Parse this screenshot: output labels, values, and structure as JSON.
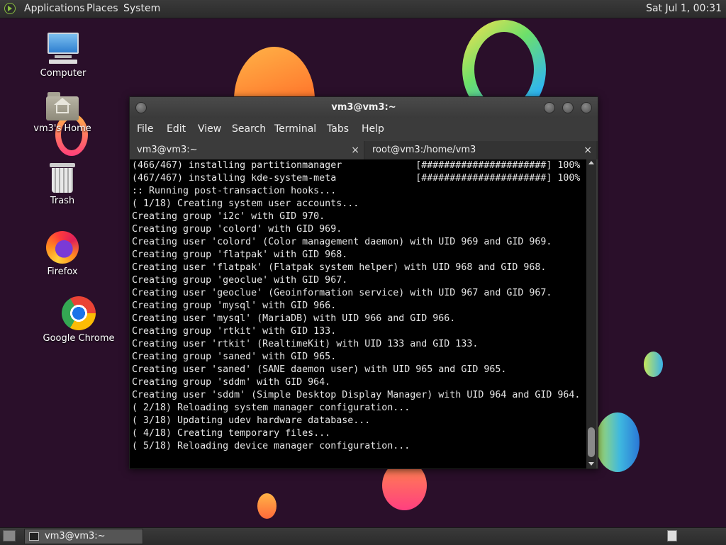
{
  "top_panel": {
    "menus": [
      "Applications",
      "Places",
      "System"
    ],
    "clock": "Sat Jul  1, 00:31",
    "distro_icon": "distro-logo-icon"
  },
  "desktop_icons": [
    {
      "label": "Computer",
      "icon": "computer-icon"
    },
    {
      "label": "vm3's Home",
      "icon": "home-folder-icon"
    },
    {
      "label": "Trash",
      "icon": "trash-icon"
    },
    {
      "label": "Firefox",
      "icon": "firefox-icon"
    },
    {
      "label": "Google Chrome",
      "icon": "chrome-icon"
    }
  ],
  "terminal": {
    "title": "vm3@vm3:~",
    "menu": [
      "File",
      "Edit",
      "View",
      "Search",
      "Terminal",
      "Tabs",
      "Help"
    ],
    "tabs": [
      {
        "label": "vm3@vm3:~",
        "active": true
      },
      {
        "label": "root@vm3:/home/vm3",
        "active": false
      }
    ],
    "tab_close_glyph": "×",
    "lines": [
      "(466/467) installing partitionmanager             [######################] 100%",
      "(467/467) installing kde-system-meta              [######################] 100%",
      ":: Running post-transaction hooks...",
      "( 1/18) Creating system user accounts...",
      "Creating group 'i2c' with GID 970.",
      "Creating group 'colord' with GID 969.",
      "Creating user 'colord' (Color management daemon) with UID 969 and GID 969.",
      "Creating group 'flatpak' with GID 968.",
      "Creating user 'flatpak' (Flatpak system helper) with UID 968 and GID 968.",
      "Creating group 'geoclue' with GID 967.",
      "Creating user 'geoclue' (Geoinformation service) with UID 967 and GID 967.",
      "Creating group 'mysql' with GID 966.",
      "Creating user 'mysql' (MariaDB) with UID 966 and GID 966.",
      "Creating group 'rtkit' with GID 133.",
      "Creating user 'rtkit' (RealtimeKit) with UID 133 and GID 133.",
      "Creating group 'saned' with GID 965.",
      "Creating user 'saned' (SANE daemon user) with UID 965 and GID 965.",
      "Creating group 'sddm' with GID 964.",
      "Creating user 'sddm' (Simple Desktop Display Manager) with UID 964 and GID 964.",
      "( 2/18) Reloading system manager configuration...",
      "( 3/18) Updating udev hardware database...",
      "( 4/18) Creating temporary files...",
      "( 5/18) Reloading device manager configuration..."
    ]
  },
  "bottom_panel": {
    "task_label": "vm3@vm3:~"
  }
}
